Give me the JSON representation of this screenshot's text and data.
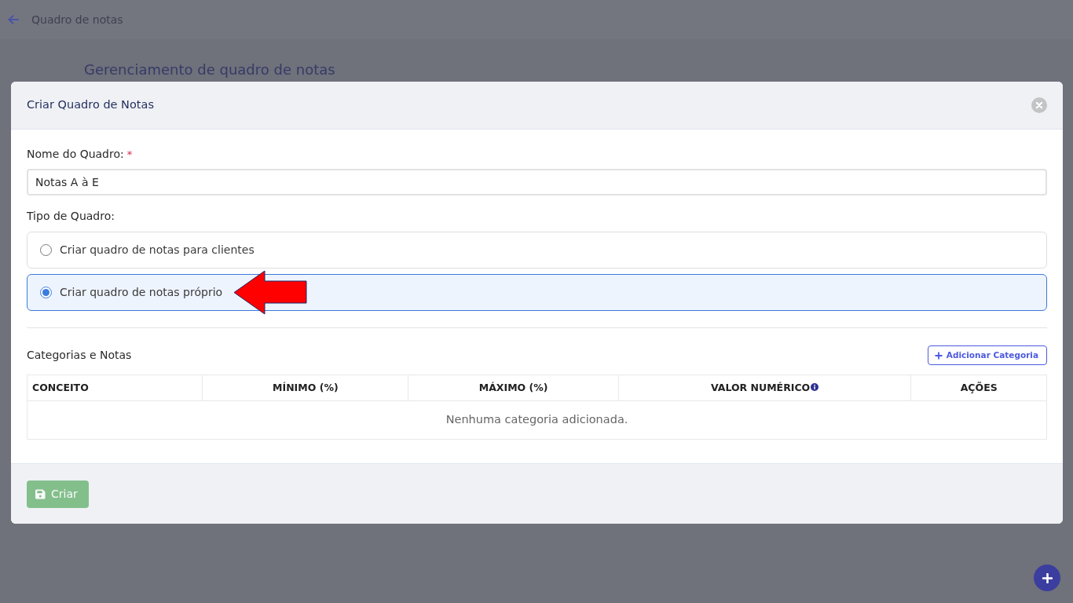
{
  "top_bar": {
    "title": "Quadro de notas"
  },
  "page": {
    "heading": "Gerenciamento de quadro de notas"
  },
  "modal": {
    "title": "Criar Quadro de Notas",
    "name_field": {
      "label": "Nome do Quadro:",
      "required_mark": "*",
      "value": "Notas A à E"
    },
    "type_field": {
      "label": "Tipo de Quadro:",
      "options": [
        {
          "label": "Criar quadro de notas para clientes",
          "selected": false,
          "arrow": false
        },
        {
          "label": "Criar quadro de notas próprio",
          "selected": true,
          "arrow": true
        }
      ]
    },
    "categories": {
      "title": "Categorias e Notas",
      "add_button": "Adicionar Categoria",
      "table": {
        "columns": [
          {
            "label": "CONCEITO",
            "info": false
          },
          {
            "label": "MÍNIMO (%)",
            "info": false
          },
          {
            "label": "MÁXIMO (%)",
            "info": false
          },
          {
            "label": "VALOR NUMÉRICO",
            "info": true
          },
          {
            "label": "AÇÕES",
            "info": false
          }
        ],
        "empty_message": "Nenhuma categoria adicionada."
      }
    },
    "footer": {
      "submit": {
        "label": "Criar",
        "disabled": true
      }
    }
  }
}
